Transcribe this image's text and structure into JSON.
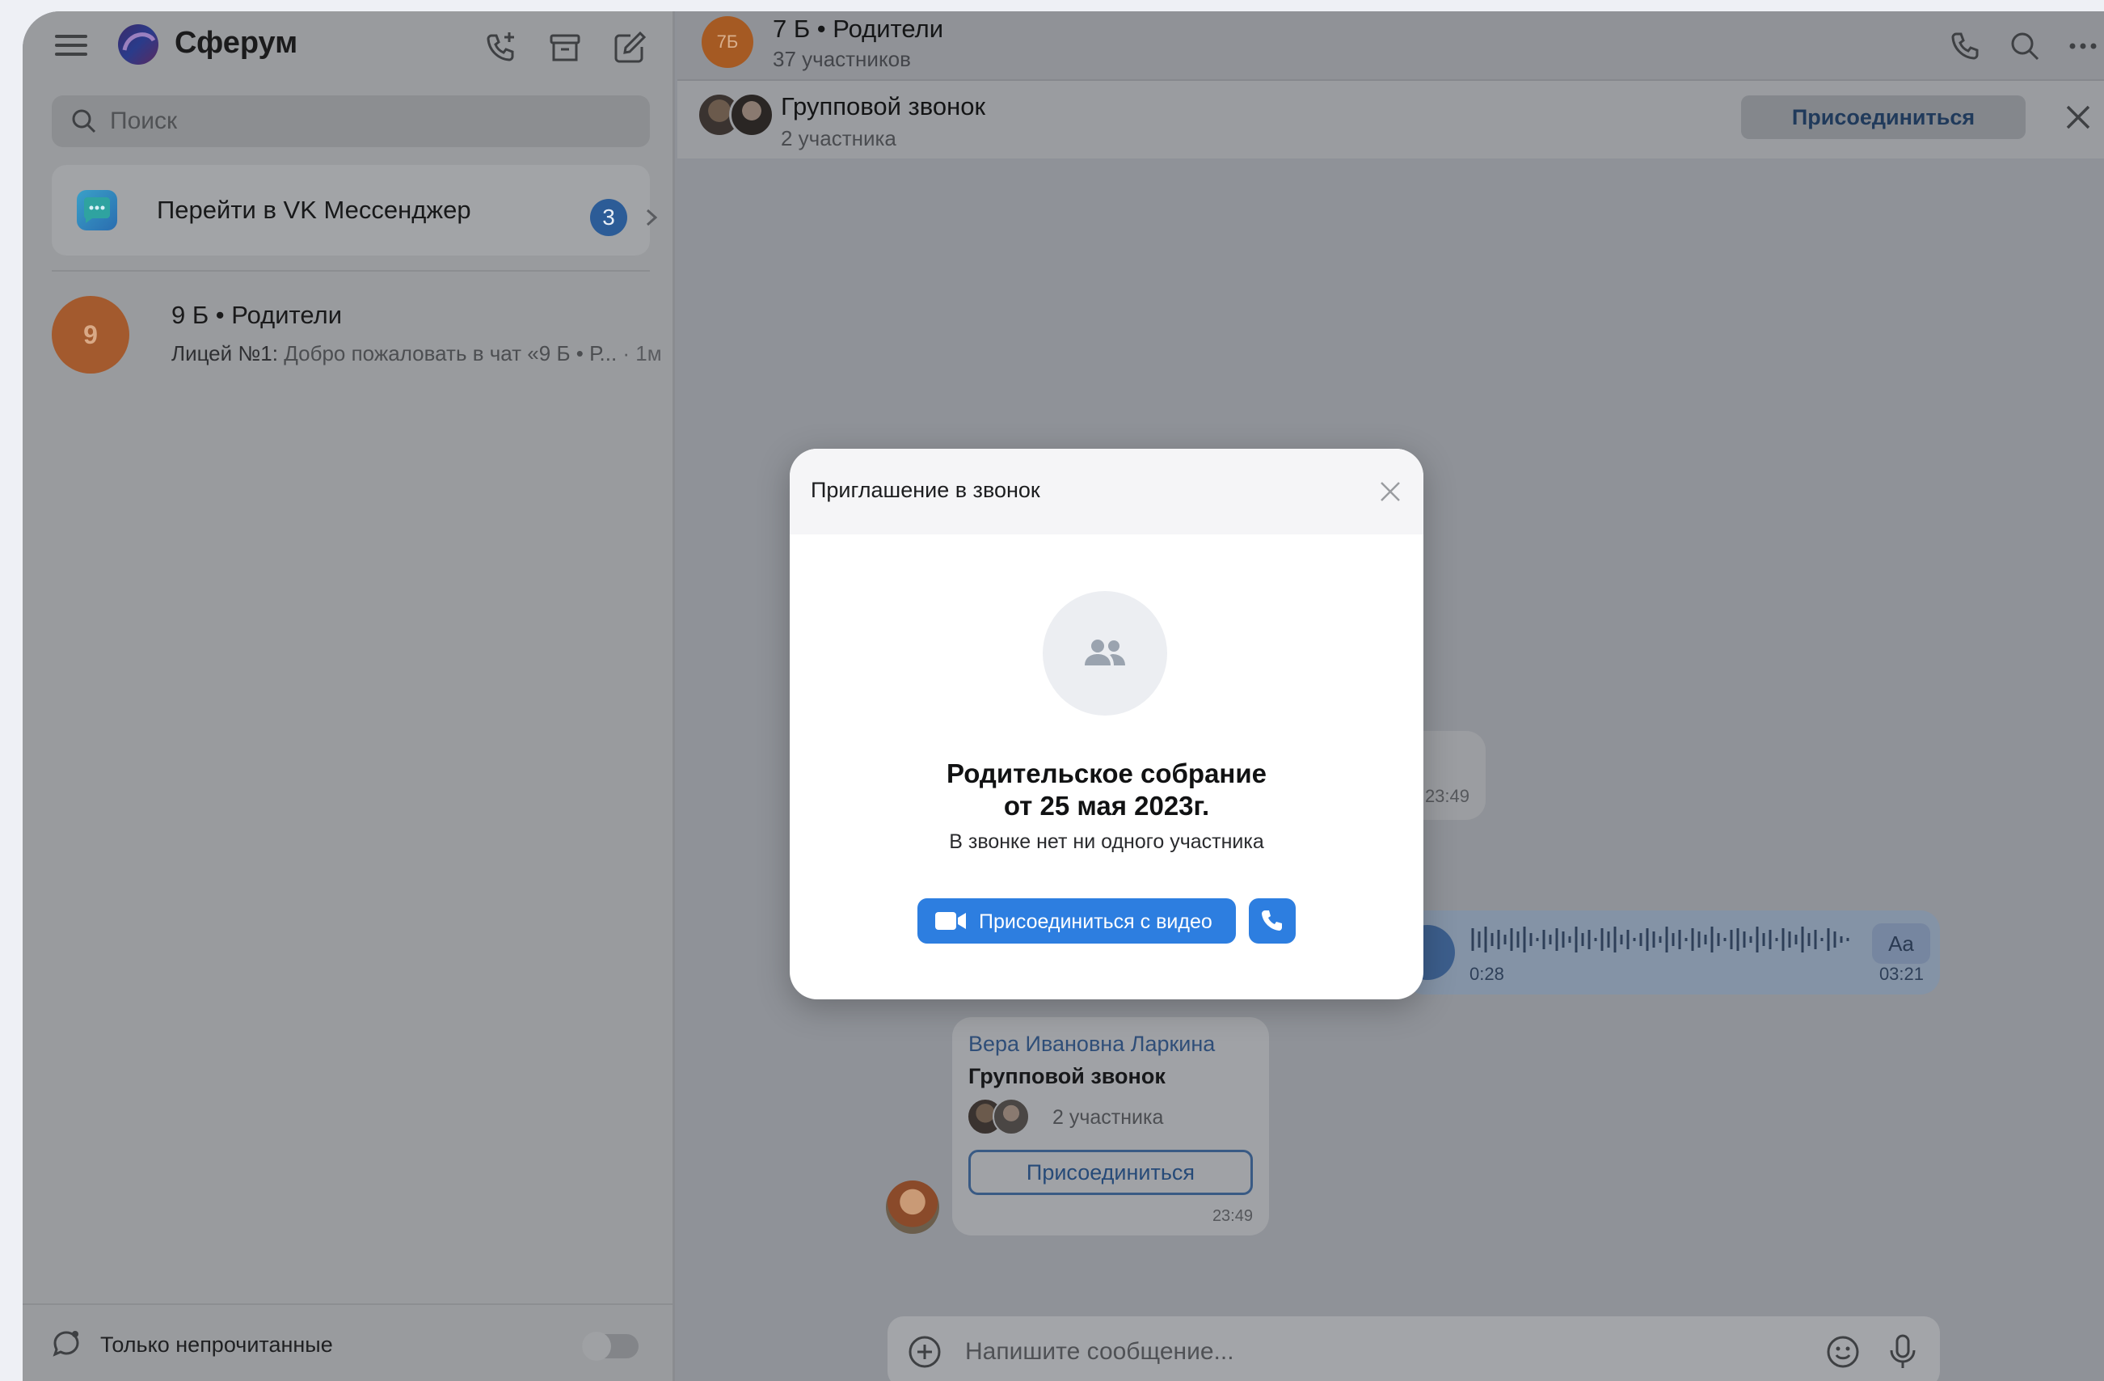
{
  "app": {
    "title": "Сферум"
  },
  "sidebar": {
    "search_placeholder": "Поиск",
    "vk_banner": {
      "label": "Перейти в VK Мессенджер",
      "badge": "3"
    },
    "chats": [
      {
        "avatar_letter": "9",
        "title": "9 Б • Родители",
        "sender": "Лицей №1:",
        "preview": "Добро пожаловать в чат «9 Б • Р...",
        "time": "· 1м"
      }
    ],
    "footer": {
      "unread_only_label": "Только непрочитанные"
    }
  },
  "chat": {
    "avatar_text": "7Б",
    "title": "7 Б • Родители",
    "subtitle": "37 участников",
    "call_bar": {
      "title": "Групповой звонок",
      "subtitle": "2 участника",
      "join_label": "Присоединиться"
    },
    "messages": {
      "bubble_time": "23:49",
      "voice": {
        "position": "0:28",
        "duration": "03:21",
        "transcribe_label": "Aa"
      },
      "call_message": {
        "sender": "Вера Ивановна Ларкина",
        "title": "Групповой звонок",
        "participants": "2 участника",
        "join_label": "Присоединиться",
        "time": "23:49"
      }
    },
    "composer": {
      "placeholder": "Напишите сообщение..."
    }
  },
  "modal": {
    "header": "Приглашение в звонок",
    "name_line1": "Родительское собрание",
    "name_line2": "от 25 мая 2023г.",
    "status": "В звонке нет ни одного участника",
    "video_button": "Присоединиться с видео"
  },
  "colors": {
    "accent": "#2d7ee0",
    "overlay_dim": "#8f9298",
    "orange_avatar": "#a55a23",
    "link_blue": "#2f4e78"
  }
}
